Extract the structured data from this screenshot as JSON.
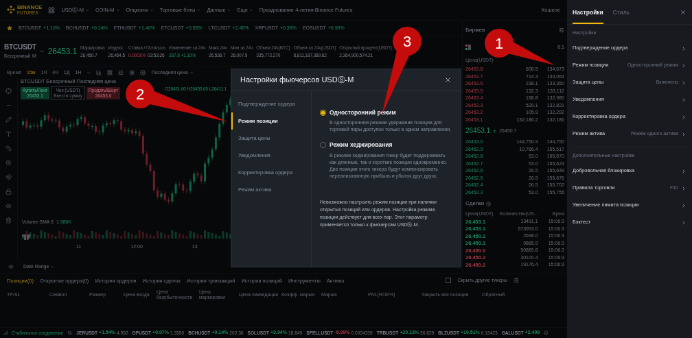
{
  "top_nav": {
    "logo": [
      "BINANCE",
      "FUTURES"
    ],
    "menu": [
      {
        "label": "USDⓈ-M",
        "caret": true
      },
      {
        "label": "COIN-M",
        "caret": true
      },
      {
        "label": "Опционы",
        "caret": true
      },
      {
        "label": "Торговые боты",
        "caret": true
      },
      {
        "label": "Данные",
        "caret": true
      },
      {
        "label": "Еще",
        "caret": true
      },
      {
        "label": "Празднование 4-летия Binance Futures",
        "caret": false
      }
    ],
    "right_link": "Кошеле"
  },
  "favorites": [
    {
      "symbol": "BTCUSDT",
      "change": "+1.10%"
    },
    {
      "symbol": "BCHUSDT",
      "change": "+0.14%"
    },
    {
      "symbol": "ETHUSDT",
      "change": "+1.40%"
    },
    {
      "symbol": "ETCUSDT",
      "change": "+0.55%"
    },
    {
      "symbol": "LTCUSDT",
      "change": "+2.45%"
    },
    {
      "symbol": "XRPUSDT",
      "change": "+0.39%"
    },
    {
      "symbol": "EOSUSDT",
      "change": "+0.90%"
    }
  ],
  "symbol_header": {
    "symbol": "BTCUSDT",
    "type": "Бессрочный",
    "type_badge": "M",
    "price": "26453.1",
    "stats": [
      {
        "label": "Маркировка",
        "values": [
          "26,450.7"
        ]
      },
      {
        "label": "Индекс",
        "values": [
          "26,464.5"
        ]
      },
      {
        "label": "Ставка / Осталось",
        "values": [
          "0.0001%",
          "03:53:26"
        ]
      },
      {
        "label": "Изменение за 24ч",
        "values": [
          "287.8 +1.10%"
        ]
      },
      {
        "label": "Макс 24ч",
        "values": [
          "26,536.7"
        ]
      },
      {
        "label": "Мин за 24ч",
        "values": [
          "26,007.9"
        ]
      },
      {
        "label": "Объем 24ч(BTC)",
        "values": [
          "335,772.270"
        ]
      },
      {
        "label": "Объем за 24ч(USDT)",
        "values": [
          "8,811,187,389.62"
        ]
      },
      {
        "label": "Открытый процент(USDT)",
        "values": [
          "2,364,900,574.21"
        ]
      }
    ]
  },
  "chart_toolbar": {
    "label": "Время",
    "intervals": [
      {
        "label": "15м",
        "selected": true
      },
      {
        "label": "1Ч",
        "selected": false
      },
      {
        "label": "4Ч",
        "selected": false
      },
      {
        "label": "1Д",
        "selected": false
      },
      {
        "label": "1Н",
        "selected": false
      }
    ],
    "price_type": "Последняя цена"
  },
  "chart": {
    "legend": "BTCUSDT Бессрочный Последняя цена",
    "ohlc": "O26431.60 H26455.60 L26411.1",
    "buy": {
      "label": "Купить/Лонг",
      "price": "26453.1"
    },
    "amount": {
      "label": "Чек (USDT)",
      "placeholder": "Ввести сумму"
    },
    "sell": {
      "label": "Продать/Шорт",
      "price": "26453.0"
    },
    "volume_label": "Volume SMA 9",
    "volume_value": "1.986K",
    "x_labels": [
      "11",
      "12:00",
      "13"
    ],
    "date_range": "Date Range"
  },
  "order_book": {
    "title": "Биржев",
    "step": "0.1",
    "columns": [
      "Цена(USDT)"
    ],
    "asks": [
      [
        "26453.8",
        "608.5",
        "134,673"
      ],
      [
        "26453.7",
        "714.3",
        "134,064"
      ],
      [
        "26453.6",
        "238.1",
        "133,350"
      ],
      [
        "26453.5",
        "132.3",
        "133,112"
      ],
      [
        "26453.4",
        "158.8",
        "132,980"
      ],
      [
        "26453.3",
        "529.1",
        "132,821"
      ],
      [
        "26453.2",
        "105.9",
        "132,292"
      ],
      [
        "26453.1",
        "132,186.2",
        "132,186"
      ]
    ],
    "last_price": "26453.1",
    "mark_price": "26450.7",
    "bids": [
      [
        "26453.0",
        "144,750.9",
        "144,750"
      ],
      [
        "26452.9",
        "10,766.4",
        "155,517"
      ],
      [
        "26452.8",
        "53.0",
        "155,570"
      ],
      [
        "26452.7",
        "53.0",
        "155,623"
      ],
      [
        "26452.6",
        "26.5",
        "155,649"
      ],
      [
        "26452.5",
        "26.5",
        "155,676"
      ],
      [
        "26452.4",
        "26.5",
        "155,702"
      ],
      [
        "26452.3",
        "53.0",
        "155,755"
      ]
    ]
  },
  "trades": {
    "title": "Сделки",
    "columns": [
      "Цена(USDT)",
      "Количество(US...",
      "Врем"
    ],
    "rows": [
      {
        "price": "26,453.1",
        "amount": "13491.1",
        "time": "15:06:3",
        "color": "#1f8a60"
      },
      {
        "price": "26,453.1",
        "amount": "573953.0",
        "time": "15:06:3",
        "color": "#1f8a60"
      },
      {
        "price": "26,450.1",
        "amount": "2698.0",
        "time": "15:06:3",
        "color": "#1f8a60"
      },
      {
        "price": "26,450.1",
        "amount": "9865.9",
        "time": "15:06:3",
        "color": "#1f8a60"
      },
      {
        "price": "26,450.0",
        "amount": "50889.8",
        "time": "15:06:3",
        "color": "#a63b47"
      },
      {
        "price": "26,450.2",
        "amount": "30100.4",
        "time": "15:06:3",
        "color": "#a63b47"
      },
      {
        "price": "26,450.2",
        "amount": "19176.4",
        "time": "15:06:3",
        "color": "#a63b47"
      }
    ]
  },
  "positions": {
    "tabs": [
      {
        "label": "Позиции(0)",
        "selected": true
      },
      {
        "label": "Открытые ордера(0)",
        "selected": false
      },
      {
        "label": "История ордеров",
        "selected": false
      },
      {
        "label": "История сделок",
        "selected": false
      },
      {
        "label": "История транзакций",
        "selected": false
      },
      {
        "label": "История позиций",
        "selected": false
      },
      {
        "label": "Инструменты",
        "selected": false
      },
      {
        "label": "Активы",
        "selected": false
      }
    ],
    "hide_others": {
      "label": "Скрыть другие тикеры",
      "checked": false
    },
    "columns": [
      "TP/SL",
      "Символ",
      "Размер",
      "Цена входа",
      "Цена безубыточности",
      "Цена маркировки",
      "Цена ликвидации",
      "Коэфф. маржи",
      "Маржа",
      "PNL(ROE%)",
      "Закрыть все позиции",
      "Обратный"
    ]
  },
  "status_bar": {
    "connection": "Стабильное соединение",
    "tickers": [
      {
        "symbol": "JERUSDT",
        "change": "+1.54%",
        "price": "4.952",
        "color": "#1f8a60"
      },
      {
        "symbol": "OPUSDT",
        "change": "+0.07%",
        "price": "1.3550",
        "color": "#1f8a60"
      },
      {
        "symbol": "BCHUSDT",
        "change": "+0.14%",
        "price": "202.30",
        "color": "#1f8a60"
      },
      {
        "symbol": "SOLUSDT",
        "change": "+3.94%",
        "price": "18.849",
        "color": "#1f8a60"
      },
      {
        "symbol": "SPELLUSDT",
        "change": "-6.99%",
        "price": "0.0004339",
        "color": "#a63b47"
      },
      {
        "symbol": "TRBUSDT",
        "change": "+20.13%",
        "price": "30.829",
        "color": "#1f8a60"
      },
      {
        "symbol": "BLZUSDT",
        "change": "+10.51%",
        "price": "0.15423",
        "color": "#1f8a60"
      },
      {
        "symbol": "GALUSDT",
        "change": "+2.409",
        "color": "#1f8a60"
      }
    ]
  },
  "modal": {
    "title": "Настройки фьючерсов USDⓈ-M",
    "nav": [
      {
        "label": "Подтверждение ордера",
        "selected": false
      },
      {
        "label": "Режим позиции",
        "selected": true
      },
      {
        "label": "Защита цены",
        "selected": false
      },
      {
        "label": "Уведомления",
        "selected": false
      },
      {
        "label": "Корректировка ордера",
        "selected": false
      },
      {
        "label": "Режим актива",
        "selected": false
      }
    ],
    "options": [
      {
        "title": "Односторонний режим",
        "selected": true,
        "description": "В одностороннем режиме удержание позиции для торговой пары доступно только в одном направлении."
      },
      {
        "title": "Режим хеджирования",
        "selected": false,
        "description": "В режиме хеджирования тикер будет поддерживать как длинные, так и короткие позиции одновременно. Две позиции этого тикера будут компенсировать нереализованную прибыль и убыток друг друга."
      }
    ],
    "note": "Невозможно настроить режим позиции при наличии открытых позиций или ордеров. Настройка режима позиции действует для всех пар. Этот параметр применяется только к фьючерсам USDⓈ-M."
  },
  "settings_panel": {
    "tabs": [
      {
        "label": "Настройки",
        "selected": true
      },
      {
        "label": "Стиль",
        "selected": false
      }
    ],
    "sections": [
      {
        "title": "Настройки",
        "items": [
          {
            "label": "Подтверждение ордера"
          },
          {
            "label": "Режим позиции",
            "value": "Односторонний режим"
          },
          {
            "label": "Защита цены",
            "value": "Включено"
          },
          {
            "label": "Уведомления"
          },
          {
            "label": "Корректировка ордера"
          },
          {
            "label": "Режим актива",
            "value": "Режим одного актива"
          }
        ]
      },
      {
        "title": "Дополнительные настройки",
        "items": [
          {
            "label": "Добровольная блокировка"
          },
          {
            "label": "Правила торговли",
            "value": "F10"
          },
          {
            "label": "Увеличение лимита позиции"
          },
          {
            "label": "Бэктест"
          }
        ]
      }
    ]
  },
  "callouts": [
    {
      "number": "1"
    },
    {
      "number": "2"
    },
    {
      "number": "3"
    }
  ]
}
